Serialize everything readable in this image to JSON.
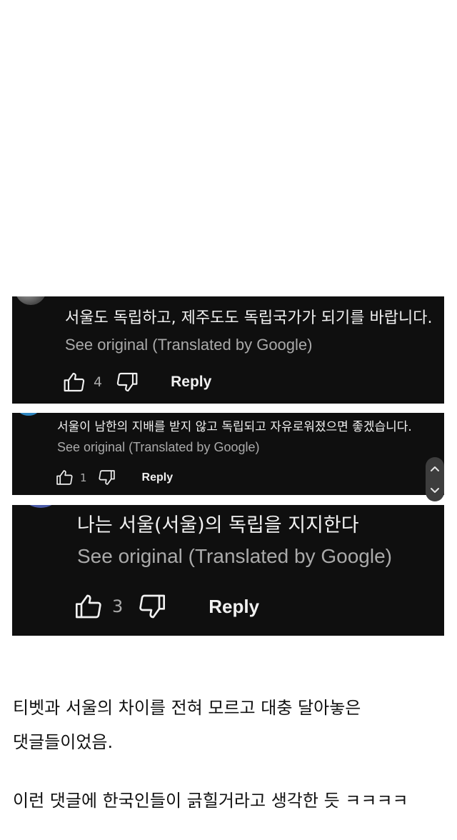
{
  "comments": [
    {
      "text": "서울도 독립하고, 제주도도 독립국가가 되기를 바랍니다.",
      "see_original": "See original (Translated by Google)",
      "likes": "4",
      "reply_label": "Reply"
    },
    {
      "text": "서울이 남한의 지배를 받지 않고 독립되고 자유로워졌으면 좋겠습니다.",
      "see_original": "See original (Translated by Google)",
      "likes": "1",
      "reply_label": "Reply"
    },
    {
      "text": "나는 서울(서울)의 독립을 지지한다",
      "see_original": "See original (Translated by Google)",
      "likes": "3",
      "reply_label": "Reply"
    }
  ],
  "post": {
    "paragraph1": "티벳과 서울의 차이를 전혀 모르고 대충 달아놓은 댓글들이었음.",
    "paragraph2": "이런 댓글에 한국인들이 긁힐거라고 생각한 듯 ㅋㅋㅋㅋ"
  },
  "icons": {
    "like": "thumbs-up-icon",
    "dislike": "thumbs-down-icon",
    "scroll_up": "chevron-up-icon",
    "scroll_down": "chevron-down-icon"
  },
  "colors": {
    "card_background": "#0f0f0f",
    "primary_text": "#f1f1f1",
    "secondary_text": "#aaaaaa",
    "page_background": "#ffffff"
  }
}
